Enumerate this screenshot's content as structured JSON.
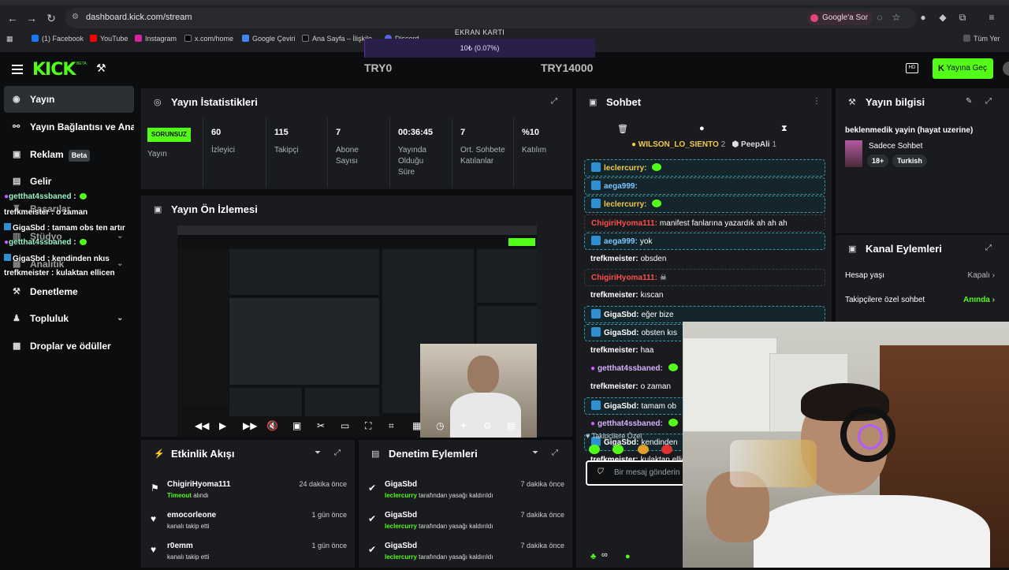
{
  "browser": {
    "url": "dashboard.kick.com/stream",
    "google_ask": "Google'a Sor",
    "bookmarks": [
      "(1) Facebook",
      "YouTube",
      "Instagram",
      "x.com/home",
      "Google Çeviri",
      "Ana Sayfa – İlişkile",
      "Discord",
      "Tüm Yer"
    ]
  },
  "overlay": {
    "gpu_label": "EKRAN KARTI",
    "gpu_text": "10₺ (0.07%)",
    "gpu_progress": 0.0007,
    "try_min": "TRY0",
    "try_max": "TRY14000"
  },
  "topbar": {
    "logo": "KICK",
    "logo_beta": "BETA",
    "go_live_label": "Yayına Geç"
  },
  "sidebar": {
    "items": [
      {
        "label": "Yayın",
        "icon": "play-circle-icon"
      },
      {
        "label": "Yayın Bağlantısı ve Anahtarı",
        "icon": "link-icon"
      },
      {
        "label": "Reklam",
        "beta": "Beta",
        "icon": "megaphone-icon"
      },
      {
        "label": "Gelir",
        "icon": "money-icon"
      },
      {
        "label": "Başarılar",
        "icon": "trophy-icon"
      },
      {
        "label": "Stüdyo",
        "icon": "studio-icon"
      },
      {
        "label": "Analitik",
        "icon": "chart-icon"
      },
      {
        "label": "Denetleme",
        "icon": "wrench-icon"
      },
      {
        "label": "Topluluk",
        "icon": "community-icon"
      },
      {
        "label": "Droplar ve ödüller",
        "icon": "gift-icon"
      }
    ],
    "overlay_chat": [
      {
        "name": "getthat4ssbaned",
        "text": ":"
      },
      {
        "name": "trefkmeister",
        "text": ": o zaman"
      },
      {
        "name": "GigaSbd",
        "text": ": tamam obs ten artır"
      },
      {
        "name": "getthat4ssbaned",
        "text": ":"
      },
      {
        "name": "GigaSbd",
        "text": ": kendinden nkıs"
      },
      {
        "name": "trefkmeister",
        "text": ": kulaktan ellicen"
      }
    ]
  },
  "stats": {
    "title": "Yayın İstatistikleri",
    "status_badge": "SORUNSUZ",
    "status_label": "Yayın",
    "items": [
      {
        "value": "60",
        "label": "İzleyici"
      },
      {
        "value": "115",
        "label": "Takipçi"
      },
      {
        "value": "7",
        "label": "Abone Sayısı"
      },
      {
        "value": "00:36:45",
        "label": "Yayında Olduğu Süre"
      },
      {
        "value": "7",
        "label": "Ort. Sohbete Katılanlar"
      },
      {
        "value": "%10",
        "label": "Katılım"
      }
    ]
  },
  "preview": {
    "title": "Yayın Ön İzlemesi"
  },
  "activity": {
    "title": "Etkinlik Akışı",
    "items": [
      {
        "name": "ChigiriHyoma111",
        "highlight": "Timeout",
        "desc": "alındı",
        "time": "24 dakika önce"
      },
      {
        "name": "emocorleone",
        "highlight": "",
        "desc": "kanalı takip etti",
        "time": "1 gün önce"
      },
      {
        "name": "r0emm",
        "highlight": "",
        "desc": "kanalı takip etti",
        "time": "1 gün önce"
      }
    ]
  },
  "moderation": {
    "title": "Denetim Eylemleri",
    "items": [
      {
        "name": "GigaSbd",
        "highlight": "leclercurry",
        "desc": "tarafından yasağı kaldırıldı",
        "time": "7 dakika önce"
      },
      {
        "name": "GigaSbd",
        "highlight": "leclercurry",
        "desc": "tarafından yasağı kaldırıldı",
        "time": "7 dakika önce"
      },
      {
        "name": "GigaSbd",
        "highlight": "leclercurry",
        "desc": "tarafından yasağı kaldırıldı",
        "time": "7 dakika önce"
      }
    ]
  },
  "chat": {
    "title": "Sohbet",
    "pinned_1": "WILSON_LO_SIENTO",
    "pinned_1_count": "2",
    "pinned_2": "PeepAli",
    "pinned_2_count": "1",
    "messages": [
      {
        "user": "leclercurry:",
        "text": "",
        "style": "hl",
        "color": "y",
        "badge": true,
        "emote": true
      },
      {
        "user": "aega999:",
        "text": "",
        "style": "hl",
        "color": "b",
        "badge": true,
        "emote": false
      },
      {
        "user": "leclercurry:",
        "text": "",
        "style": "hl",
        "color": "y",
        "badge": true,
        "emote": true
      },
      {
        "user": "ChigiriHyoma111:",
        "text": "manifest fanlarına yazardık ah ah ah",
        "style": "hl2",
        "color": "r",
        "badge": false,
        "emote": false
      },
      {
        "user": "aega999:",
        "text": "yok",
        "style": "hl",
        "color": "b",
        "badge": true,
        "emote": false
      },
      {
        "user": "trefkmeister:",
        "text": "obsden",
        "style": "",
        "color": "",
        "badge": false,
        "emote": false
      },
      {
        "user": "ChigiriHyoma111:",
        "text": "☠",
        "style": "hl2",
        "color": "r",
        "badge": false,
        "emote": false
      },
      {
        "user": "trefkmeister:",
        "text": "kıscan",
        "style": "",
        "color": "",
        "badge": false,
        "emote": false
      },
      {
        "user": "GigaSbd:",
        "text": "eğer bize",
        "style": "hl",
        "color": "",
        "badge": true,
        "emote": false
      },
      {
        "user": "GigaSbd:",
        "text": "obsten kıs",
        "style": "hl",
        "color": "",
        "badge": true,
        "emote": false
      },
      {
        "user": "trefkmeister:",
        "text": "haa",
        "style": "",
        "color": "",
        "badge": false,
        "emote": false
      },
      {
        "user": "getthat4ssbaned:",
        "text": "",
        "style": "",
        "color": "p",
        "badge": false,
        "emote": true
      },
      {
        "user": "trefkmeister:",
        "text": "o zaman",
        "style": "",
        "color": "",
        "badge": false,
        "emote": false
      },
      {
        "user": "GigaSbd:",
        "text": "tamam ob",
        "style": "hl",
        "color": "",
        "badge": true,
        "emote": false
      },
      {
        "user": "getthat4ssbaned:",
        "text": "",
        "style": "",
        "color": "p",
        "badge": false,
        "emote": true
      },
      {
        "user": "GigaSbd:",
        "text": "kendinden",
        "style": "hl",
        "color": "",
        "badge": true,
        "emote": false
      },
      {
        "user": "trefkmeister:",
        "text": "kulaktan ellic",
        "style": "",
        "color": "",
        "badge": false,
        "emote": false
      }
    ],
    "followers_only": "Takipçilere Özel",
    "input_placeholder": "Bir mesaj gönderin"
  },
  "stream_info": {
    "title": "Yayın bilgisi",
    "stream_title": "beklenmedik yayin (hayat uzerine)",
    "category": "Sadece Sohbet",
    "tags": [
      "18+",
      "Turkish"
    ]
  },
  "channel_actions": {
    "title": "Kanal Eylemleri",
    "rows": [
      {
        "label": "Hesap yaşı",
        "value": "Kapalı"
      },
      {
        "label": "Takipçilere özel sohbet",
        "value": "Anında"
      }
    ]
  },
  "colors": {
    "accent": "#53fc18",
    "panel": "#191b1f",
    "background": "#0b0d0e"
  }
}
